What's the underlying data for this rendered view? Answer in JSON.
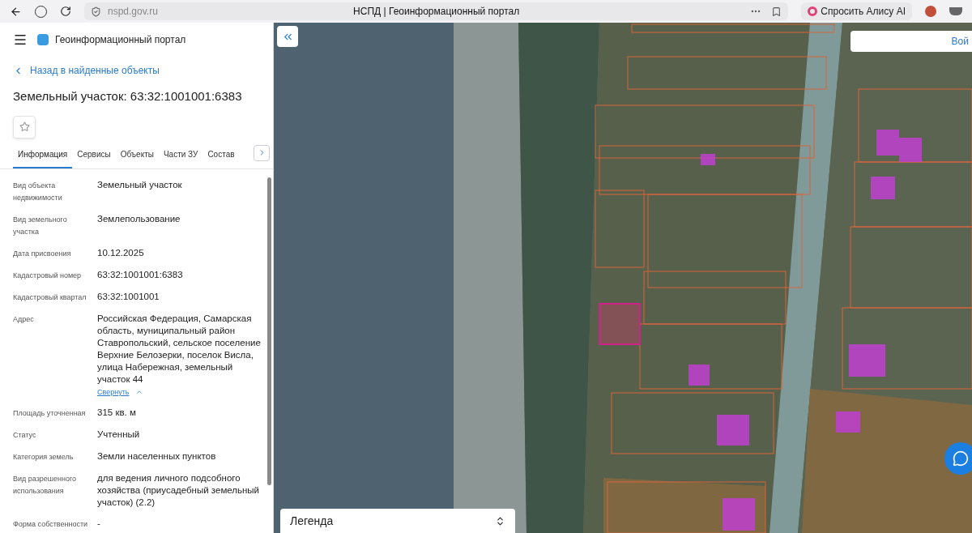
{
  "browser": {
    "url": "nspd.gov.ru",
    "tab_title": "НСПД | Геоинформационный портал",
    "assistant_button": "Спросить Алису AI"
  },
  "portal": {
    "title": "Геоинформационный портал"
  },
  "back_link": "Назад в найденные объекты",
  "heading": "Земельный участок: 63:32:1001001:6383",
  "favorite": {
    "selected": false
  },
  "tabs": [
    {
      "label": "Информация",
      "selected": true
    },
    {
      "label": "Сервисы",
      "selected": false
    },
    {
      "label": "Объекты",
      "selected": false
    },
    {
      "label": "Части ЗУ",
      "selected": false
    },
    {
      "label": "Состав",
      "selected": false
    }
  ],
  "fields": [
    {
      "label": "Вид объекта недвижимости",
      "value": "Земельный участок"
    },
    {
      "label": "Вид земельного участка",
      "value": "Землепользование"
    },
    {
      "label": "Дата присвоения",
      "value": "10.12.2025"
    },
    {
      "label": "Кадастровый номер",
      "value": "63:32:1001001:6383"
    },
    {
      "label": "Кадастровый квартал",
      "value": "63:32:1001001"
    },
    {
      "label": "Адрес",
      "value": "Российская Федерация, Самарская область, муниципальный район Ставропольский, сельское поселение Верхние Белозерки, поселок Висла, улица Набережная, земельный участок 44",
      "collapse_link": "Свернуть"
    },
    {
      "label": "Площадь уточненная",
      "value": "315 кв. м"
    },
    {
      "label": "Статус",
      "value": "Учтенный"
    },
    {
      "label": "Категория земель",
      "value": "Земли населенных пунктов"
    },
    {
      "label": "Вид разрешенного использования",
      "value": "для ведения личного подсобного хозяйства (приусадебный земельный участок) (2.2)"
    },
    {
      "label": "Форма собственности",
      "value": "-"
    }
  ],
  "map": {
    "login_button": "Вой",
    "legend": "Легенда"
  }
}
